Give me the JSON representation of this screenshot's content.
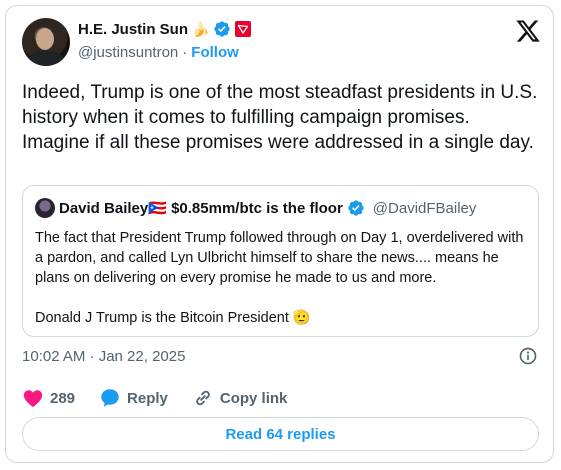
{
  "author": {
    "display_name": "H.E. Justin Sun",
    "handle": "@justinsuntron",
    "separator": "·",
    "follow_label": "Follow",
    "emoji": "🍌"
  },
  "tweet": {
    "text": "Indeed, Trump is one of the most steadfast presidents in U.S. history when it comes to fulfilling campaign promises. Imagine if all these promises were addressed in a single day."
  },
  "quote": {
    "display_name": "David Bailey",
    "flag_emoji": "🇵🇷",
    "name_suffix": " $0.85mm/btc is the floor",
    "handle": "@DavidFBailey",
    "paragraph1": "The fact that President Trump followed through on Day 1, overdelivered with a pardon, and called Lyn Ulbricht himself to share the news.... means he plans on delivering on every promise he made to us and more.",
    "paragraph2": "Donald J Trump is the Bitcoin President 🫡"
  },
  "meta": {
    "timestamp": "10:02 AM · Jan 22, 2025"
  },
  "actions": {
    "likes": "289",
    "reply_label": "Reply",
    "copy_label": "Copy link"
  },
  "replies_button": "Read 64 replies",
  "colors": {
    "accent": "#1d9bf0",
    "like": "#f91880",
    "verified": "#1d9bf0",
    "tron_badge": "#eb0029",
    "muted": "#536471",
    "border": "#cfd9de"
  },
  "icons": [
    "verified-icon",
    "tron-badge-icon",
    "x-logo-icon",
    "info-icon",
    "heart-icon",
    "reply-bubble-icon",
    "link-icon"
  ]
}
